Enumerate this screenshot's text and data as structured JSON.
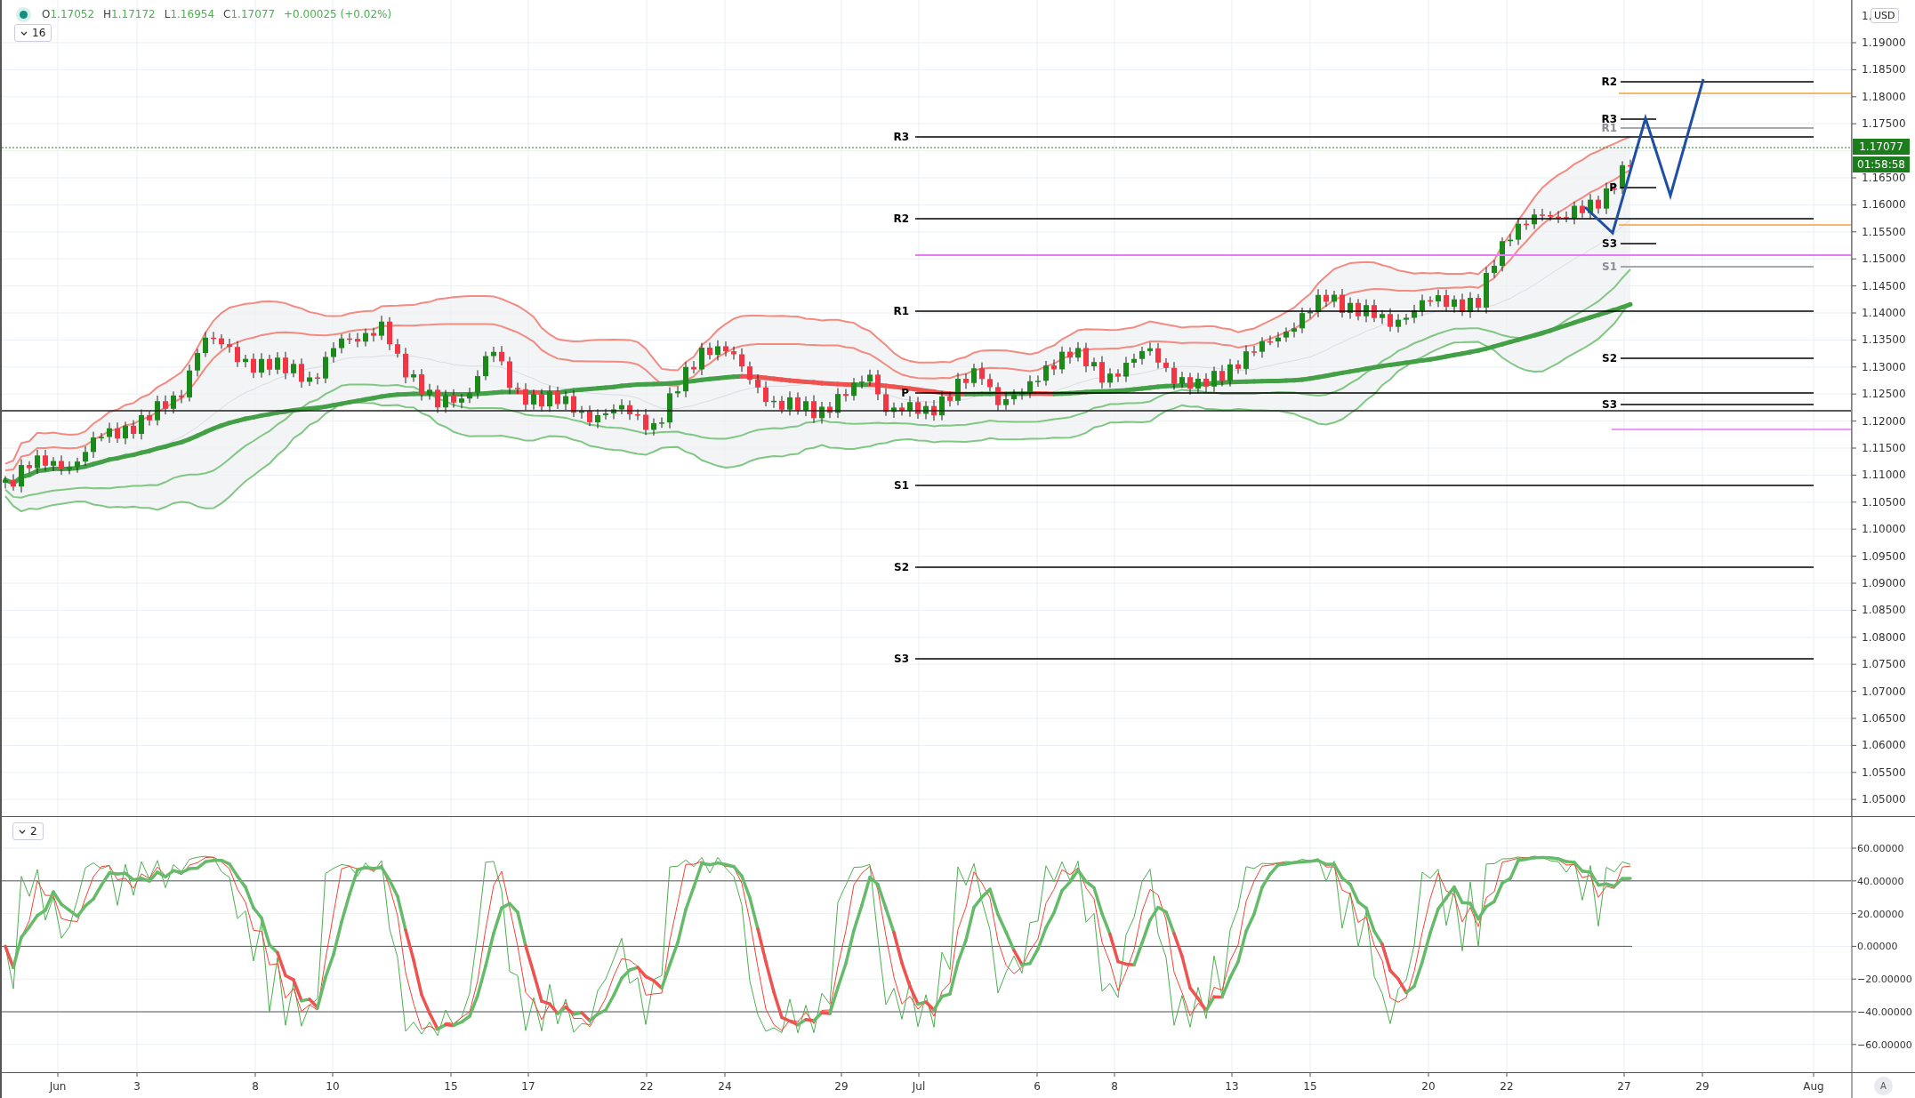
{
  "legend": {
    "ohlc": [
      {
        "label": "O",
        "value": "1.17052"
      },
      {
        "label": "H",
        "value": "1.17172"
      },
      {
        "label": "L",
        "value": "1.16954"
      },
      {
        "label": "C",
        "value": "1.17077"
      }
    ],
    "change": "+0.00025 (+0.02%)",
    "indicator_count": "16"
  },
  "price_axis": {
    "top_label": "1.",
    "currency": "USD",
    "ticks": [
      "1.19000",
      "1.18500",
      "1.18000",
      "1.17500",
      "1.16500",
      "1.16000",
      "1.15500",
      "1.15000",
      "1.14500",
      "1.14000",
      "1.13500",
      "1.13000",
      "1.12500",
      "1.12000",
      "1.11500",
      "1.11000",
      "1.10500",
      "1.10000",
      "1.09500",
      "1.09000",
      "1.08500",
      "1.08000",
      "1.07500",
      "1.07000",
      "1.06500",
      "1.06000",
      "1.05500",
      "1.05000"
    ],
    "last_price": "1.17077",
    "countdown": "01:58:58"
  },
  "pivots_monthly": [
    {
      "label": "R3",
      "color": "#000000"
    },
    {
      "label": "R2",
      "color": "#000000"
    },
    {
      "label": "R1",
      "color": "#000000"
    },
    {
      "label": "P",
      "color": "#000000"
    },
    {
      "label": "S1",
      "color": "#000000"
    },
    {
      "label": "S2",
      "color": "#000000"
    },
    {
      "label": "S3",
      "color": "#000000"
    }
  ],
  "pivots_weekly": [
    {
      "label": "R2",
      "color": "#000000"
    },
    {
      "label": "R3",
      "color": "#000000"
    },
    {
      "label": "R1",
      "color": "#8a8d96"
    },
    {
      "label": "P",
      "color": "#000000"
    },
    {
      "label": "S3",
      "color": "#000000"
    },
    {
      "label": "S1",
      "color": "#8a8d96"
    },
    {
      "label": "S2",
      "color": "#000000"
    },
    {
      "label": "S3",
      "color": "#000000"
    }
  ],
  "oscillator": {
    "indicator_count": "2",
    "ticks": [
      "60.00000",
      "40.00000",
      "20.00000",
      "0.00000",
      "−20.00000",
      "−40.00000",
      "−60.00000"
    ]
  },
  "time_axis": {
    "labels": [
      "Jun",
      "3",
      "8",
      "10",
      "15",
      "17",
      "22",
      "24",
      "29",
      "Jul",
      "6",
      "8",
      "13",
      "15",
      "20",
      "22",
      "27",
      "29",
      "Aug"
    ],
    "auto_button": "A"
  }
}
